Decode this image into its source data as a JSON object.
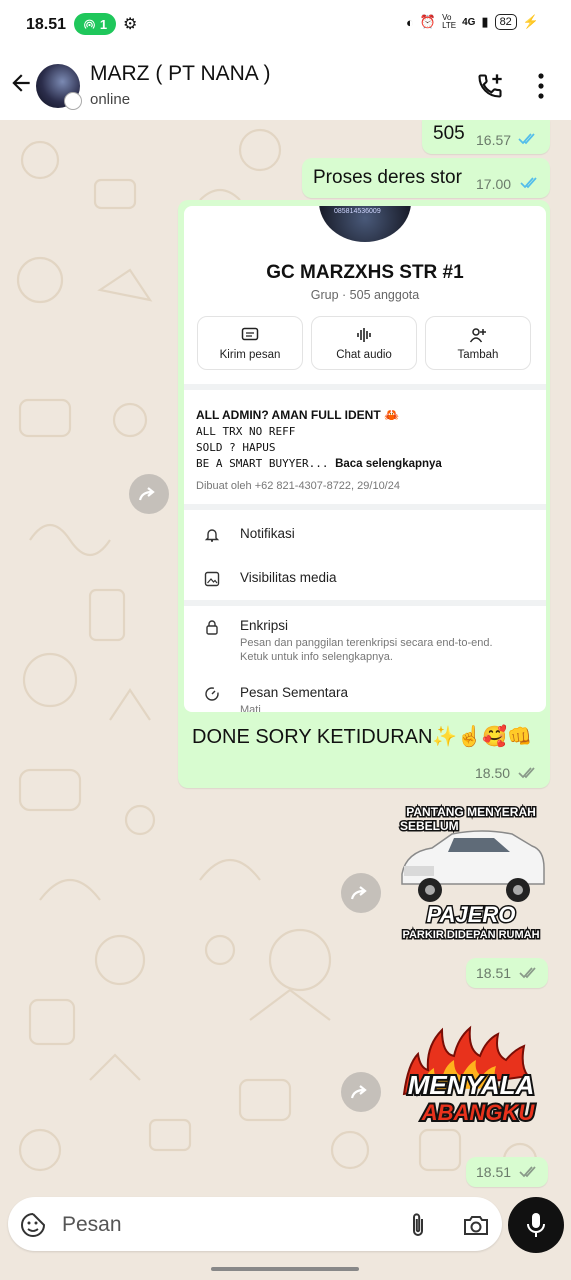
{
  "status_bar": {
    "time": "18.51",
    "hotspot_count": "1",
    "network": "4G",
    "network_label": "Vo LTE",
    "battery": "82"
  },
  "header": {
    "contact_name": "MARZ ( PT NANA )",
    "status": "online"
  },
  "messages": {
    "m1": {
      "text": "505",
      "time": "16.57"
    },
    "m2": {
      "text": "Proses deres stor",
      "time": "17.00"
    },
    "m3": {
      "group_card": {
        "photo_text": "085814536009",
        "title": "GC MARZXHS STR #1",
        "subtitle": "Grup · 505 anggota",
        "actions": [
          {
            "label": "Kirim pesan"
          },
          {
            "label": "Chat audio"
          },
          {
            "label": "Tambah"
          }
        ],
        "description_title": "ALL ADMIN? AMAN FULL IDENT",
        "description_lines": [
          "ALL TRX NO REFF",
          "SOLD ? HAPUS",
          "BE A SMART BUYYER..."
        ],
        "read_more": "Baca selengkapnya",
        "created_by": "Dibuat oleh +62 821-4307-8722, 29/10/24",
        "rows": {
          "notifications": "Notifikasi",
          "media_visibility": "Visibilitas media",
          "encryption": "Enkripsi",
          "encryption_sub_1": "Pesan dan panggilan terenkripsi secara end-to-end.",
          "encryption_sub_2": "Ketuk untuk info selengkapnya.",
          "disappearing": "Pesan Sementara",
          "disappearing_sub": "Mati"
        }
      },
      "text": "DONE SORY KETIDURAN✨☝️🥰👊",
      "time": "18.50"
    },
    "m4": {
      "sticker_top_1": "PANTANG MENYERAH",
      "sticker_top_2": "SEBELUM",
      "sticker_brand": "PAJERO",
      "sticker_bottom": "PARKIR DIDEPAN RUMAH",
      "time": "18.51"
    },
    "m5": {
      "sticker_line_1": "MENYALA",
      "sticker_line_2": "ABANGKU",
      "time": "18.51"
    }
  },
  "input": {
    "placeholder": "Pesan"
  },
  "colors": {
    "bubble": "#d8fcd0",
    "read_tick": "#53bdeb",
    "delivered_tick": "#8a9a8a",
    "chat_bg": "#efe7dd",
    "hotspot_pill": "#1fc75b"
  },
  "icons": [
    "back-arrow-icon",
    "add-call-icon",
    "more-vert-icon",
    "forward-icon",
    "double-tick-icon",
    "message-icon",
    "audio-wave-icon",
    "add-person-icon",
    "bell-icon",
    "image-icon",
    "lock-icon",
    "timer-icon",
    "sticker-icon",
    "attach-icon",
    "camera-icon",
    "mic-icon"
  ]
}
